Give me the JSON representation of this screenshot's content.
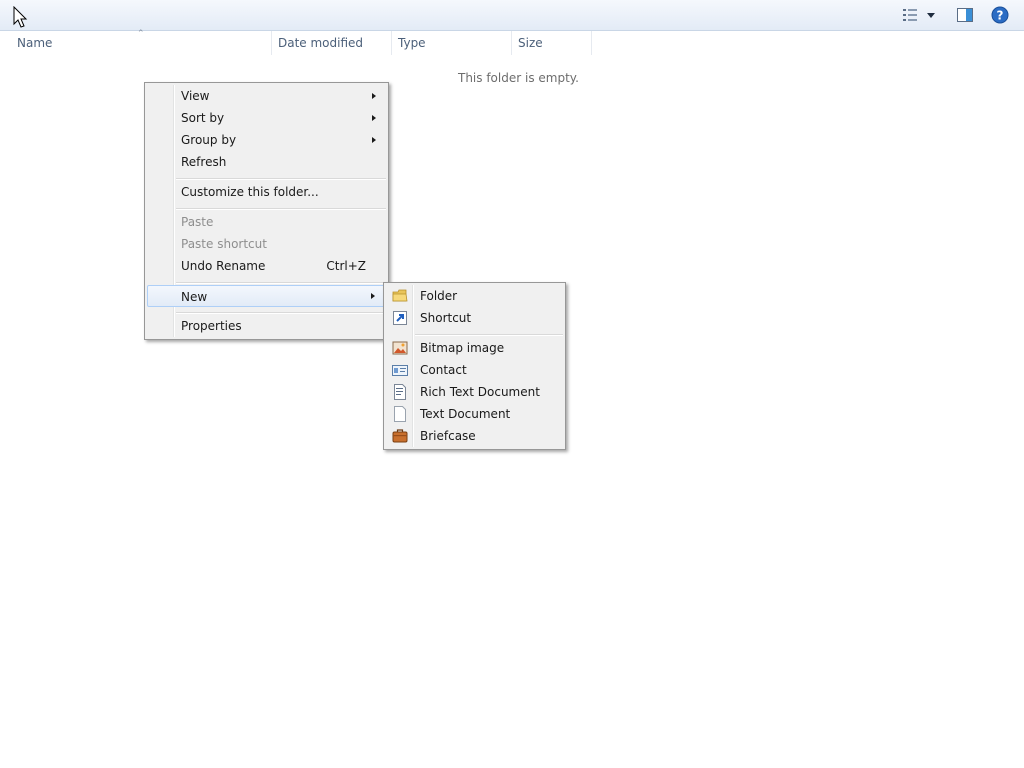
{
  "columns": [
    "Name",
    "Date modified",
    "Type",
    "Size"
  ],
  "empty_message": "This folder is empty.",
  "context_menu": {
    "view": "View",
    "sort_by": "Sort by",
    "group_by": "Group by",
    "refresh": "Refresh",
    "customize": "Customize this folder...",
    "paste": "Paste",
    "paste_shortcut": "Paste shortcut",
    "undo_rename": "Undo Rename",
    "undo_shortcut": "Ctrl+Z",
    "new": "New",
    "properties": "Properties"
  },
  "new_submenu": {
    "folder": "Folder",
    "shortcut": "Shortcut",
    "bitmap": "Bitmap image",
    "contact": "Contact",
    "rtf": "Rich Text Document",
    "text": "Text Document",
    "briefcase": "Briefcase"
  },
  "toolbar": {
    "view_icon": "list-view-icon",
    "preview_icon": "preview-pane-icon",
    "help_icon": "help-icon"
  }
}
